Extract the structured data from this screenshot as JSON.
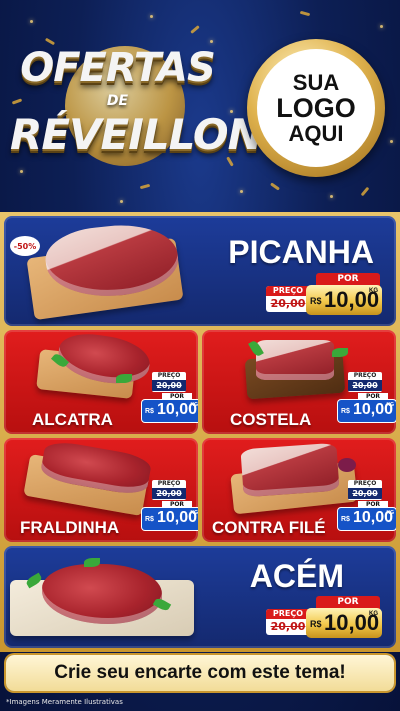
{
  "header": {
    "title_line1": "OFERTAS",
    "title_line2": "DE",
    "title_line3": "RÉVEILLON",
    "logo_line1": "SUA",
    "logo_line2": "LOGO",
    "logo_line3": "AQUI"
  },
  "products": [
    {
      "name": "PICANHA",
      "old_label": "PREÇO",
      "old_price": "20,00",
      "por_label": "POR",
      "currency": "R$",
      "price": "10,00",
      "unit": "KG",
      "badge": "-50%"
    },
    {
      "name": "ALCATRA",
      "old_label": "PREÇO",
      "old_price": "20,00",
      "por_label": "POR",
      "currency": "R$",
      "price": "10,00",
      "unit": "KG"
    },
    {
      "name": "COSTELA",
      "old_label": "PREÇO",
      "old_price": "20,00",
      "por_label": "POR",
      "currency": "R$",
      "price": "10,00",
      "unit": "KG"
    },
    {
      "name": "FRALDINHA",
      "old_label": "PREÇO",
      "old_price": "20,00",
      "por_label": "POR",
      "currency": "R$",
      "price": "10,00",
      "unit": "KG"
    },
    {
      "name": "CONTRA FILÉ",
      "old_label": "PREÇO",
      "old_price": "20,00",
      "por_label": "POR",
      "currency": "R$",
      "price": "10,00",
      "unit": "KG"
    },
    {
      "name": "ACÉM",
      "old_label": "PREÇO",
      "old_price": "20,00",
      "por_label": "POR",
      "currency": "R$",
      "price": "10,00",
      "unit": "KG"
    }
  ],
  "footer": {
    "cta": "Crie seu encarte com este tema!",
    "disclaimer": "*Imagens Meramente Ilustrativas"
  },
  "colors": {
    "background_blue": "#0d1f55",
    "card_blue": "#1d3c9a",
    "card_red": "#e11d1d",
    "gold": "#e0b34e"
  }
}
